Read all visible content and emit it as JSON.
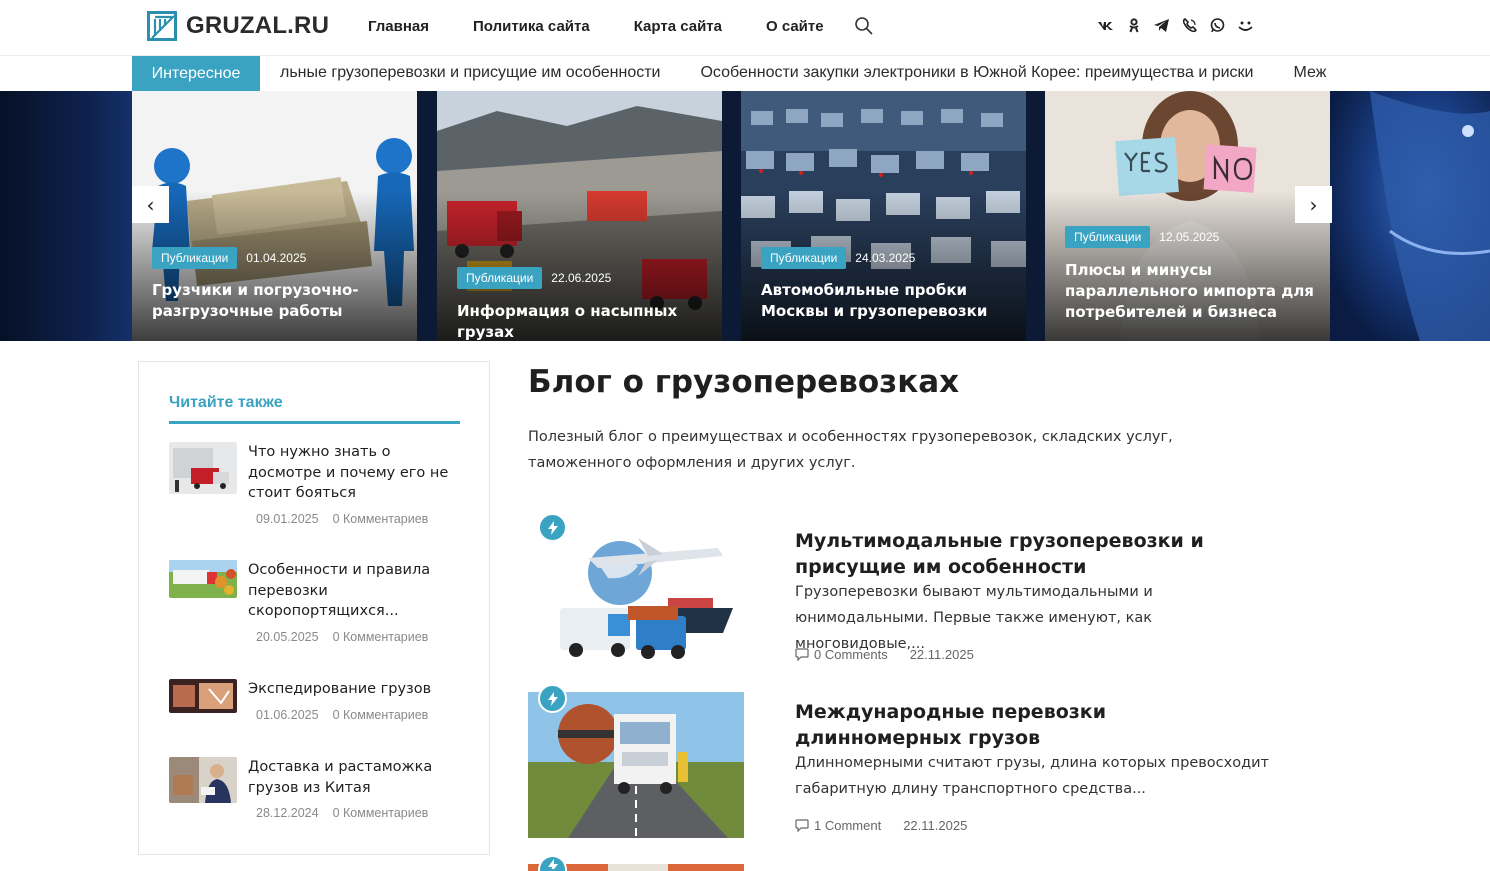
{
  "site": {
    "logo_text": "GRUZAL.RU",
    "nav": [
      "Главная",
      "Политика сайта",
      "Карта сайта",
      "О сайте"
    ],
    "socials": [
      "vk-icon",
      "ok-icon",
      "telegram-icon",
      "viber-icon",
      "whatsapp-icon",
      "mail-ru-icon"
    ]
  },
  "ticker": {
    "label": "Интересное",
    "items": [
      "льные грузоперевозки и присущие им особенности",
      "Особенности закупки электроники в Южной Корее: преимущества и риски",
      "Меж"
    ]
  },
  "slider": {
    "prev": "‹",
    "next": "›",
    "slides": [
      {
        "badge": "Публикации",
        "date": "01.04.2025",
        "title": "Грузчики и погрузочно-разгрузочные работы"
      },
      {
        "badge": "Публикации",
        "date": "22.06.2025",
        "title": "Информация о насыпных грузах"
      },
      {
        "badge": "Публикации",
        "date": "24.03.2025",
        "title": "Автомобильные пробки Москвы и грузоперевозки"
      },
      {
        "badge": "Публикации",
        "date": "12.05.2025",
        "title": "Плюсы и минусы параллельного импорта для потребителей и бизнеса"
      }
    ]
  },
  "sidebar": {
    "title": "Читайте также",
    "items": [
      {
        "title": "Что нужно знать о досмотре и почему его не стоит бояться",
        "date": "09.01.2025",
        "comments": "0 Комментариев"
      },
      {
        "title": "Особенности и правила перевозки скоропортящихся...",
        "date": "20.05.2025",
        "comments": "0 Комментариев"
      },
      {
        "title": "Экспедирование грузов",
        "date": "01.06.2025",
        "comments": "0 Комментариев"
      },
      {
        "title": "Доставка и растаможка грузов из Китая",
        "date": "28.12.2024",
        "comments": "0 Комментариев"
      }
    ]
  },
  "main": {
    "title": "Блог о грузоперевозках",
    "description": "Полезный блог о преимуществах и особенностях грузоперевозок, складских услуг, таможенного оформления и других услуг.",
    "posts": [
      {
        "title": "Мультимодальные грузоперевозки и присущие им особенности",
        "excerpt": "Грузоперевозки бывают мультимодальными и юнимодальными. Первые также именуют, как многовидовые,...",
        "comments": "0 Comments",
        "date": "22.11.2025"
      },
      {
        "title": "Международные перевозки длинномерных грузов",
        "excerpt": "Длинномерными считают грузы, длина которых превосходит габаритную длину транспортного средства...",
        "comments": "1 Comment",
        "date": "22.11.2025"
      }
    ]
  },
  "colors": {
    "accent": "#3aa3c2",
    "text": "#1f1f1f",
    "muted": "#8a8a8a"
  }
}
